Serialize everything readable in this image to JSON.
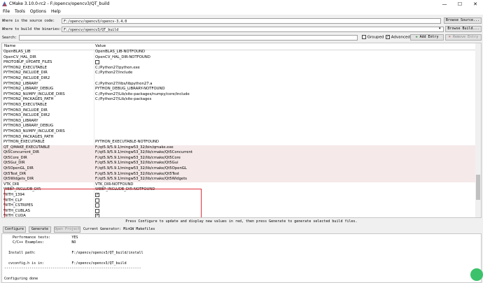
{
  "window": {
    "title": "CMake 3.10.0-rc2 - F:/opencv/opencv3/QT_build"
  },
  "menu": [
    "File",
    "Tools",
    "Options",
    "Help"
  ],
  "source": {
    "label": "Where is the source code:",
    "value": "F:/opencv/opencv3/opencv-3.4.0",
    "browse": "Browse Source..."
  },
  "binaries": {
    "label": "Where to build the binaries:",
    "value": "F:/opencv/opencv3/QT_build",
    "browse": "Browse Build..."
  },
  "search": {
    "label": "Search:",
    "value": "",
    "grouped": "Grouped",
    "advanced": "Advanced",
    "add_entry": "Add Entry",
    "remove_entry": "Remove Entry"
  },
  "table": {
    "col_name": "Name",
    "col_value": "Value",
    "rows": [
      {
        "name": "OpenBLAS_LIB",
        "value": "OpenBLAS_LIB-NOTFOUND"
      },
      {
        "name": "OpenCV_HAL_DIR",
        "value": "OpenCV_HAL_DIR-NOTFOUND"
      },
      {
        "name": "PROTOBUF_UPDATE_FILES",
        "value": "",
        "check": ""
      },
      {
        "name": "PYTHON2_EXECUTABLE",
        "value": "C:/Python27/python.exe"
      },
      {
        "name": "PYTHON2_INCLUDE_DIR",
        "value": "C:/Python27/include"
      },
      {
        "name": "PYTHON2_INCLUDE_DIR2",
        "value": ""
      },
      {
        "name": "PYTHON2_LIBRARY",
        "value": "C:/Python27/libs/libpython27.a"
      },
      {
        "name": "PYTHON2_LIBRARY_DEBUG",
        "value": "PYTHON_DEBUG_LIBRARY-NOTFOUND"
      },
      {
        "name": "PYTHON2_NUMPY_INCLUDE_DIRS",
        "value": "C:/Python27/Lib/site-packages/numpy/core/include"
      },
      {
        "name": "PYTHON2_PACKAGES_PATH",
        "value": "C:/Python27/Lib/site-packages"
      },
      {
        "name": "PYTHON3_EXECUTABLE",
        "value": ""
      },
      {
        "name": "PYTHON3_INCLUDE_DIR",
        "value": ""
      },
      {
        "name": "PYTHON3_INCLUDE_DIR2",
        "value": ""
      },
      {
        "name": "PYTHON3_LIBRARY",
        "value": ""
      },
      {
        "name": "PYTHON3_LIBRARY_DEBUG",
        "value": ""
      },
      {
        "name": "PYTHON3_NUMPY_INCLUDE_DIRS",
        "value": ""
      },
      {
        "name": "PYTHON3_PACKAGES_PATH",
        "value": ""
      },
      {
        "name": "PYTHON_EXECUTABLE",
        "value": "PYTHON_EXECUTABLE-NOTFOUND"
      },
      {
        "name": "QT_QMAKE_EXECUTABLE",
        "value": "F:/qt5.9/5.9.1/mingw53_32/bin/qmake.exe",
        "red": true
      },
      {
        "name": "Qt5Concurrent_DIR",
        "value": "F:/qt5.9/5.9.1/mingw53_32/lib/cmake/Qt5Concurrent",
        "red": true
      },
      {
        "name": "Qt5Core_DIR",
        "value": "F:/qt5.9/5.9.1/mingw53_32/lib/cmake/Qt5Core",
        "red": true
      },
      {
        "name": "Qt5Gui_DIR",
        "value": "F:/qt5.9/5.9.1/mingw53_32/lib/cmake/Qt5Gui",
        "red": true
      },
      {
        "name": "Qt5OpenGL_DIR",
        "value": "F:/qt5.9/5.9.1/mingw53_32/lib/cmake/Qt5OpenGL",
        "red": true
      },
      {
        "name": "Qt5Test_DIR",
        "value": "F:/qt5.9/5.9.1/mingw53_32/lib/cmake/Qt5Test",
        "red": true
      },
      {
        "name": "Qt5Widgets_DIR",
        "value": "F:/qt5.9/5.9.1/mingw53_32/lib/cmake/Qt5Widgets",
        "red": true
      },
      {
        "name": "VTK_DIR",
        "value": "VTK_DIR-NOTFOUND"
      },
      {
        "name": "WEBP_INCLUDE_DIR",
        "value": "WEBP_INCLUDE_DIR-NOTFOUND"
      },
      {
        "name": "WITH_1394",
        "value": "",
        "check": "✓"
      },
      {
        "name": "WITH_CLP",
        "value": "",
        "check": ""
      },
      {
        "name": "WITH_CSTRIPES",
        "value": "",
        "check": ""
      },
      {
        "name": "WITH_CUBLAS",
        "value": "",
        "check": ""
      },
      {
        "name": "WITH_CUDA",
        "value": "",
        "check": "✓"
      }
    ]
  },
  "status_text": "Press Configure to update and display new values in red, then press Generate to generate selected build files.",
  "actions": {
    "configure": "Configure",
    "generate": "Generate",
    "open_project": "Open Project",
    "generator": "Current Generator: MinGW Makefiles"
  },
  "output_lines": [
    "    Performance tests:          YES",
    "    C/C++ Examples:             NO",
    "",
    "  Install path:                 F:/opencv/opencv3/QT_build/install",
    "",
    "  cvconfig.h is in:             F:/opencv/opencv3/QT_build",
    "-----------------------------------------------------------------",
    "",
    "Configuring done"
  ]
}
